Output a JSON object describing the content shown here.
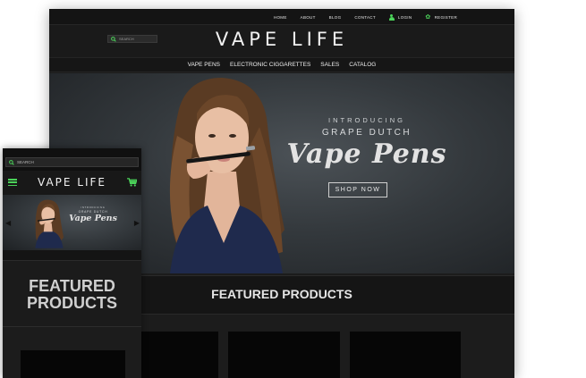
{
  "brand": {
    "name": "VAPE LIFE",
    "accent": "#4bd35a"
  },
  "desktop": {
    "top_links": [
      "HOME",
      "ABOUT",
      "BLOG",
      "CONTACT"
    ],
    "login_label": "LOGIN",
    "register_label": "REGISTER",
    "search_placeholder": "SEARCH",
    "nav": [
      "VAPE PENS",
      "ELECTRONIC CIGGARETTES",
      "SALES",
      "CATALOG"
    ],
    "hero": {
      "intro": "INTRODUCING",
      "product": "GRAPE DUTCH",
      "script": "Vape Pens",
      "cta": "SHOP NOW"
    },
    "featured_title": "FEATURED PRODUCTS"
  },
  "mobile": {
    "search_placeholder": "SEARCH",
    "hero": {
      "intro": "INTRODUCING",
      "product": "GRAPE DUTCH",
      "script": "Vape Pens"
    },
    "featured_title": "FEATURED PRODUCTS"
  },
  "icons": [
    "search-icon",
    "user-icon",
    "gear-icon",
    "menu-icon",
    "cart-icon",
    "chevron-left-icon",
    "chevron-right-icon"
  ]
}
